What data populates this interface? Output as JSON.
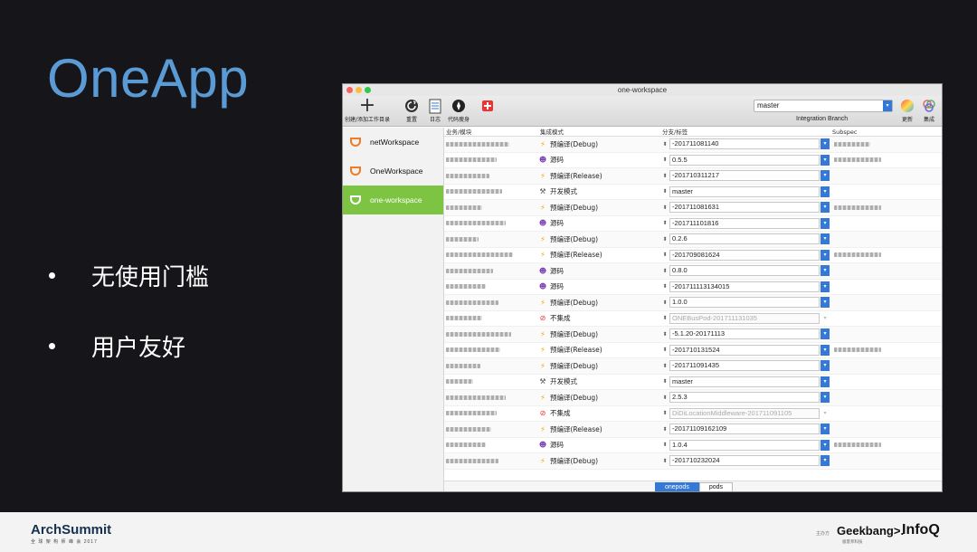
{
  "slide": {
    "title": "OneApp",
    "bullets": [
      "无使用门槛",
      "用户友好"
    ]
  },
  "window": {
    "title": "one-workspace",
    "toolbar": {
      "buttons": [
        {
          "label": "创建/添加工作目录",
          "icon": "plus-icon"
        },
        {
          "label": "重置",
          "icon": "reset-icon"
        },
        {
          "label": "日志",
          "icon": "log-icon"
        },
        {
          "label": "代码瘦身",
          "icon": "code-slim-icon"
        },
        {
          "label": "",
          "icon": "medkit-icon"
        }
      ],
      "branch_value": "master",
      "branch_label": "Integration Branch",
      "right_buttons": [
        {
          "label": "更新",
          "icon": "color-wheel-icon"
        },
        {
          "label": "集成",
          "icon": "integrate-icon"
        }
      ]
    },
    "sidebar": [
      {
        "label": "netWorkspace",
        "active": false
      },
      {
        "label": "OneWorkspace",
        "active": false
      },
      {
        "label": "one-workspace",
        "active": true
      }
    ],
    "table": {
      "headers": [
        "业务/模块",
        "集成模式",
        "分支/标签",
        "Subspec"
      ],
      "rows": [
        {
          "mode": "预编译(Debug)",
          "icon": "lightning-icon",
          "branch": "-201711081140",
          "enabled": true
        },
        {
          "mode": "源码",
          "icon": "devil-icon",
          "branch": "0.5.5",
          "enabled": true
        },
        {
          "mode": "预编译(Release)",
          "icon": "lightning-icon",
          "branch": "-201710311217",
          "enabled": true
        },
        {
          "mode": "开发模式",
          "icon": "hammer-icon",
          "branch": "master",
          "enabled": true
        },
        {
          "mode": "预编译(Debug)",
          "icon": "lightning-icon",
          "branch": "-201711081631",
          "enabled": true
        },
        {
          "mode": "源码",
          "icon": "devil-icon",
          "branch": "-201711101816",
          "enabled": true
        },
        {
          "mode": "预编译(Debug)",
          "icon": "lightning-icon",
          "branch": "0.2.6",
          "enabled": true
        },
        {
          "mode": "预编译(Release)",
          "icon": "lightning-icon",
          "branch": "-201709081624",
          "enabled": true
        },
        {
          "mode": "源码",
          "icon": "devil-icon",
          "branch": "0.8.0",
          "enabled": true
        },
        {
          "mode": "源码",
          "icon": "devil-icon",
          "branch": "-201711113134015",
          "enabled": true
        },
        {
          "mode": "预编译(Debug)",
          "icon": "lightning-icon",
          "branch": "1.0.0",
          "enabled": true
        },
        {
          "mode": "不集成",
          "icon": "prohibited-icon",
          "branch": "ONEBusPod-201711131035",
          "enabled": false
        },
        {
          "mode": "预编译(Debug)",
          "icon": "lightning-icon",
          "branch": "-5.1.20-20171113",
          "enabled": true
        },
        {
          "mode": "预编译(Release)",
          "icon": "lightning-icon",
          "branch": "-201710131524",
          "enabled": true
        },
        {
          "mode": "预编译(Debug)",
          "icon": "lightning-icon",
          "branch": "-201711091435",
          "enabled": true
        },
        {
          "mode": "开发模式",
          "icon": "hammer-icon",
          "branch": "master",
          "enabled": true
        },
        {
          "mode": "预编译(Debug)",
          "icon": "lightning-icon",
          "branch": "2.5.3",
          "enabled": true
        },
        {
          "mode": "不集成",
          "icon": "prohibited-icon",
          "branch": "DiDiLocationMiddleware-201711091105",
          "enabled": false
        },
        {
          "mode": "预编译(Release)",
          "icon": "lightning-icon",
          "branch": "-20171109162109",
          "enabled": true
        },
        {
          "mode": "源码",
          "icon": "devil-icon",
          "branch": "1.0.4",
          "enabled": true
        },
        {
          "mode": "预编译(Debug)",
          "icon": "lightning-icon",
          "branch": "-201710232024",
          "enabled": true
        }
      ]
    },
    "tabs": [
      "onepods",
      "pods"
    ],
    "active_tab": "onepods"
  },
  "footer": {
    "arch_logo": "ArchSummit",
    "arch_sub": "全 球 架 构 师 峰 会 2017",
    "sponsor_label": "主办方",
    "geek": "Geekbang>.",
    "geek_sub": "极客邦科技",
    "infoq": "InfoQ"
  },
  "colors": {
    "title_blue": "#5b9bd5",
    "active_green": "#7cc442",
    "select_blue": "#3478d8",
    "logo_orange": "#f37b24"
  }
}
